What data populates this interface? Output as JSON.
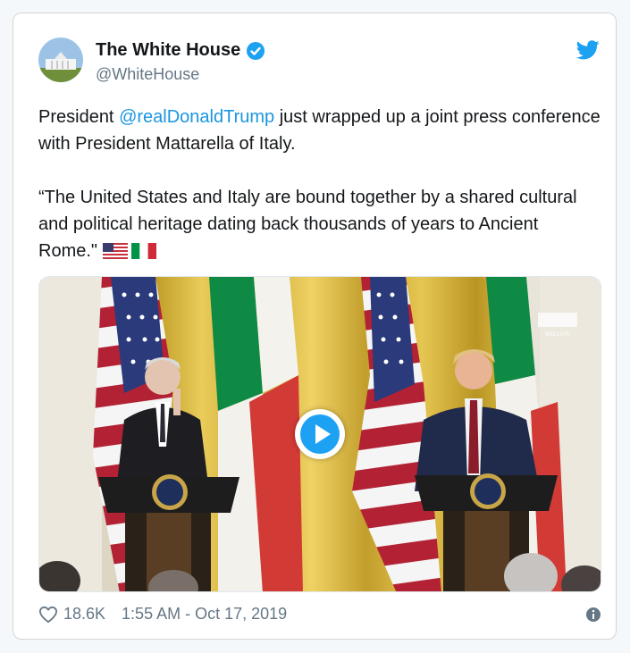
{
  "account": {
    "display_name": "The White House",
    "handle": "@WhiteHouse",
    "verified": true
  },
  "tweet": {
    "text_before_mention": "President ",
    "mention": "@realDonaldTrump",
    "text_after_mention": " just wrapped up a joint press conference with President Mattarella of Italy.",
    "quote": "“The United States and Italy are bound together by a shared cultural and political heritage dating back thousands of years to Ancient Rome.\"",
    "emoji": [
      "us-flag",
      "italy-flag"
    ]
  },
  "media": {
    "type": "video",
    "watermark": "WH.GOV"
  },
  "footer": {
    "likes": "18.6K",
    "timestamp": "1:55 AM - Oct 17, 2019"
  },
  "colors": {
    "link": "#1b95e0",
    "verified": "#1da1f2",
    "twitter_bird": "#1da1f2",
    "text": "#14171a",
    "muted": "#657786"
  }
}
